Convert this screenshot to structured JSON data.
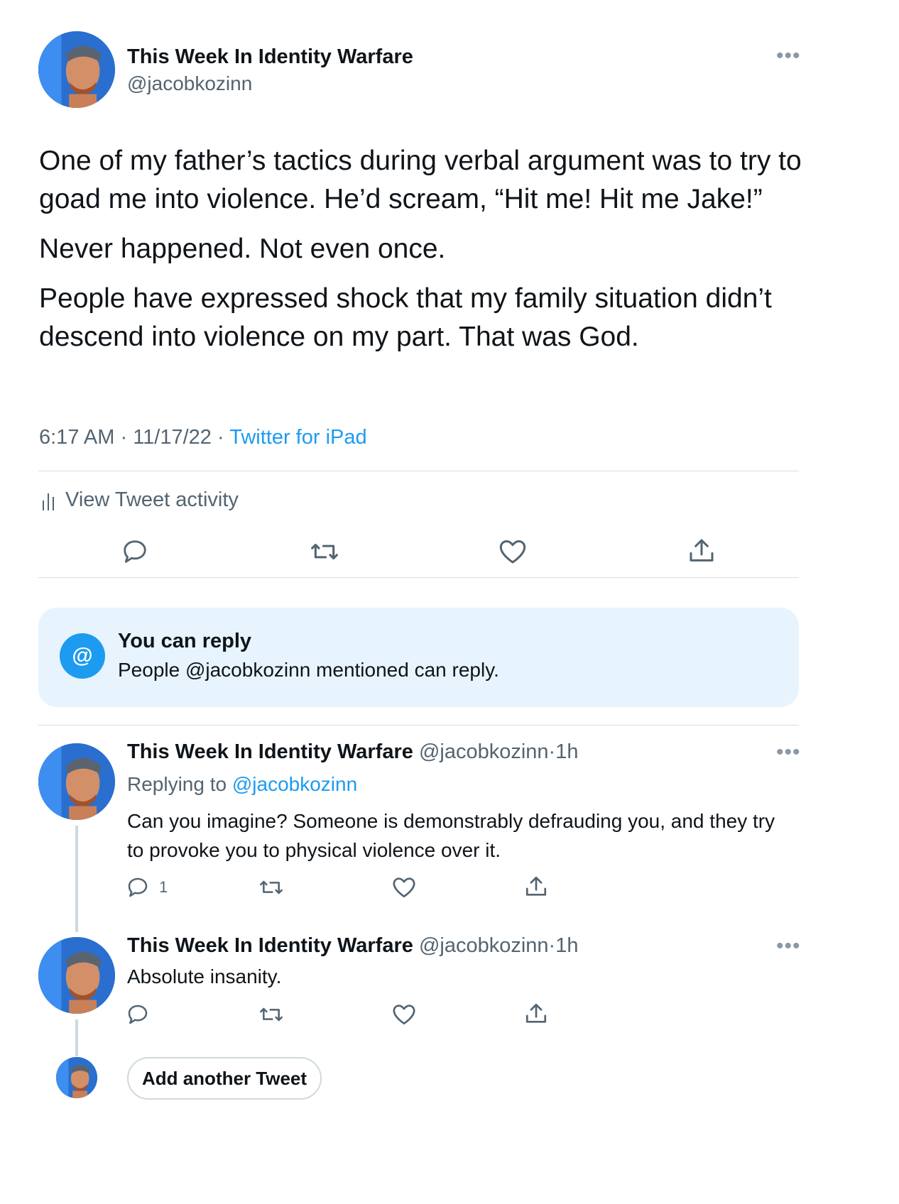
{
  "main_tweet": {
    "display_name": "This Week In Identity Warfare",
    "handle": "@jacobkozinn",
    "more_icon": "more-icon",
    "paragraphs": [
      "One of my father’s tactics during verbal argument was to try to goad me into violence. He’d scream, “Hit me! Hit me Jake!”",
      "Never happened. Not even once.",
      "People have expressed shock that my family situation didn’t descend into violence on my part. That was God."
    ],
    "time": "6:17 AM",
    "date": "11/17/22",
    "dot": "·",
    "source": "Twitter for iPad",
    "activity_label": "View Tweet activity"
  },
  "reply_notice": {
    "title": "You can reply",
    "body": "People @jacobkozinn mentioned can reply.",
    "icon_glyph": "@"
  },
  "thread": [
    {
      "display_name": "This Week In Identity Warfare",
      "handle": "@jacobkozinn",
      "time": "1h",
      "dot": "·",
      "replying_prefix": "Replying to",
      "replying_handle": "@jacobkozinn",
      "text": "Can you imagine? Someone is demonstrably defrauding you, and they try to provoke you to physical violence over it.",
      "reply_count": "1"
    },
    {
      "display_name": "This Week In Identity Warfare",
      "handle": "@jacobkozinn",
      "time": "1h",
      "dot": "·",
      "text": "Absolute insanity."
    }
  ],
  "composer": {
    "add_button_label": "Add another Tweet"
  },
  "colors": {
    "accent": "#1d9bf0",
    "muted": "#536471",
    "notice_bg": "#e7f4fd"
  }
}
